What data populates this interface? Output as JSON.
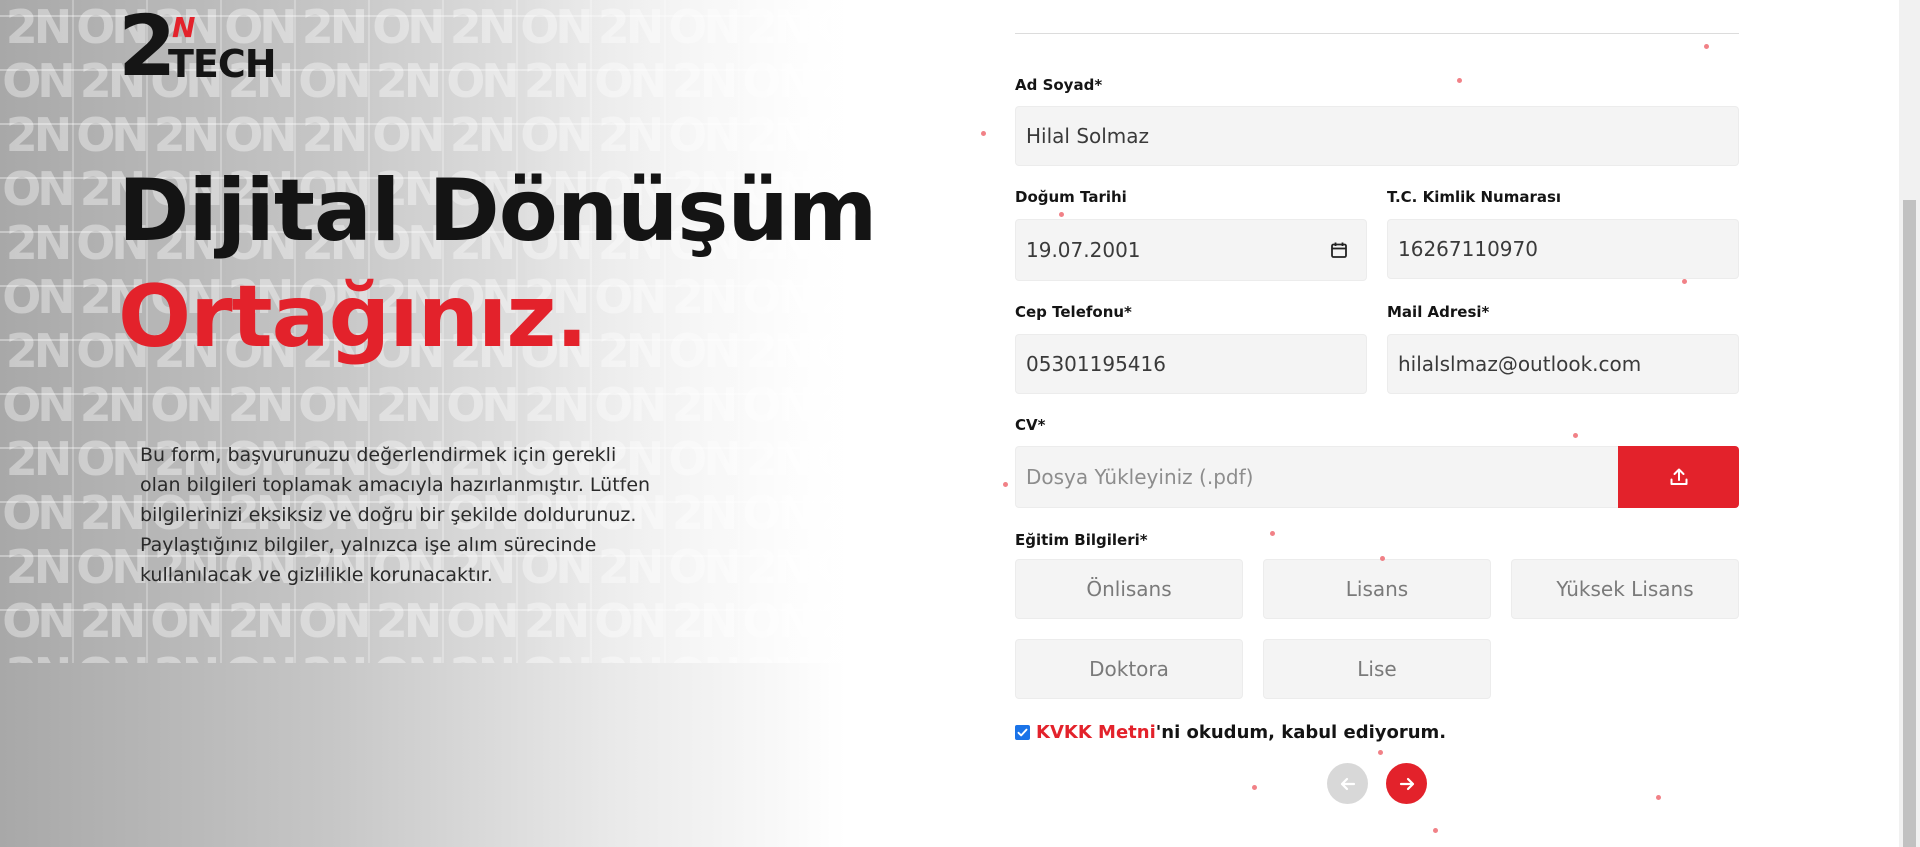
{
  "brand": {
    "logo_number": "2",
    "logo_n": "N",
    "logo_word": "TECH",
    "accent_color": "#e3222b",
    "dark_color": "#141414"
  },
  "hero": {
    "headline_line1": "Dijital Dönüşüm",
    "headline_line2": "Ortağınız.",
    "intro": "Bu form, başvurunuzu değerlendirmek için gerekli olan bilgileri toplamak amacıyla hazırlanmıştır. Lütfen bilgilerinizi eksiksiz ve doğru bir şekilde doldurunuz. Paylaştığınız bilgiler, yalnızca işe alım sürecinde kullanılacak ve gizlilikle korunacaktır."
  },
  "form": {
    "full_name": {
      "label": "Ad Soyad*",
      "value": "Hilal Solmaz"
    },
    "birth_date": {
      "label": "Doğum Tarihi",
      "value": "19.07.2001",
      "icon": "calendar-icon"
    },
    "tc_id": {
      "label": "T.C. Kimlik Numarası",
      "value": "16267110970"
    },
    "phone": {
      "label": "Cep Telefonu*",
      "value": "05301195416"
    },
    "email": {
      "label": "Mail Adresi*",
      "value": "hilalslmaz@outlook.com"
    },
    "cv": {
      "label": "CV*",
      "placeholder": "Dosya Yükleyiniz (.pdf)",
      "icon": "upload-icon"
    },
    "education": {
      "label": "Eğitim Bilgileri*",
      "options": [
        "Önlisans",
        "Lisans",
        "Yüksek Lisans",
        "Doktora",
        "Lise"
      ]
    },
    "kvkk": {
      "checked": true,
      "link_text": "KVKK Metni",
      "suffix": "'ni okudum, kabul ediyorum."
    },
    "nav": {
      "prev_icon": "arrow-left-icon",
      "next_icon": "arrow-right-icon"
    }
  }
}
